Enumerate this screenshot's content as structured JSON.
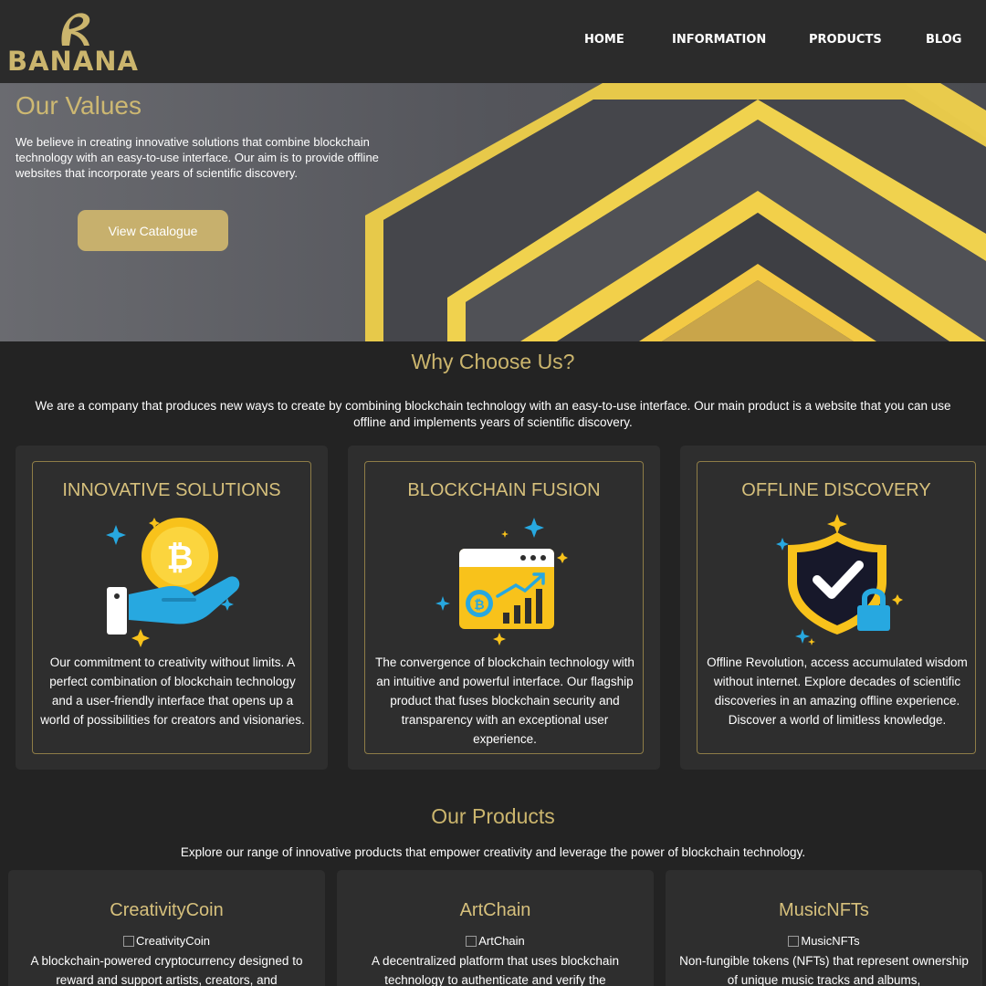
{
  "brand": {
    "name": "BANANA",
    "accent": "#cbb56d"
  },
  "nav": [
    {
      "label": "HOME"
    },
    {
      "label": "INFORMATION"
    },
    {
      "label": "PRODUCTS"
    },
    {
      "label": "BLOG"
    }
  ],
  "hero": {
    "title": "Our Values",
    "text": "We believe in creating innovative solutions that combine blockchain technology with an easy-to-use interface. Our aim is to provide offline websites that incorporate years of scientific discovery.",
    "button": "View Catalogue"
  },
  "why": {
    "title": "Why Choose Us?",
    "text": "We are a company that produces new ways to create by combining blockchain technology with an easy-to-use interface. Our main product is a website that you can use offline and implements years of scientific discovery.",
    "features": [
      {
        "title": "INNOVATIVE SOLUTIONS",
        "icon": "hand-bitcoin-icon",
        "desc": "Our commitment to creativity without limits. A perfect combination of blockchain technology and a user-friendly interface that opens up a world of possibilities for creators and visionaries."
      },
      {
        "title": "BLOCKCHAIN FUSION",
        "icon": "browser-chart-icon",
        "desc": "The convergence of blockchain technology with an intuitive and powerful interface. Our flagship product that fuses blockchain security and transparency with an exceptional user experience."
      },
      {
        "title": "OFFLINE DISCOVERY",
        "icon": "shield-lock-icon",
        "desc": "Offline Revolution, access accumulated wisdom without internet. Explore decades of scientific discoveries in an amazing offline experience. Discover a world of limitless knowledge."
      }
    ]
  },
  "products": {
    "title": "Our Products",
    "text": "Explore our range of innovative products that empower creativity and leverage the power of blockchain technology.",
    "items": [
      {
        "title": "CreativityCoin",
        "img_alt": "CreativityCoin",
        "desc": "A blockchain-powered cryptocurrency designed to reward and support artists, creators, and"
      },
      {
        "title": "ArtChain",
        "img_alt": "ArtChain",
        "desc": "A decentralized platform that uses blockchain technology to authenticate and verify the"
      },
      {
        "title": "MusicNFTs",
        "img_alt": "MusicNFTs",
        "desc": "Non-fungible tokens (NFTs) that represent ownership of unique music tracks and albums,"
      }
    ]
  },
  "colors": {
    "background": "#232323",
    "card": "#2e2e2e",
    "gold": "#cbb56d",
    "hero_gray": "#5c5d63",
    "icon_yellow": "#f8c21b",
    "icon_blue": "#27a8e0"
  }
}
